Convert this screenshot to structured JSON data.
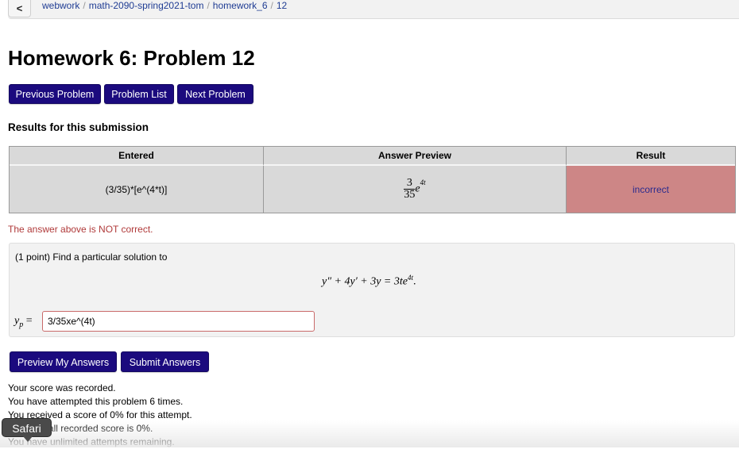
{
  "breadcrumb": {
    "back_icon": "chevron-left-icon",
    "back_glyph": "<",
    "items": [
      "webwork",
      "math-2090-spring2021-tom",
      "homework_6",
      "12"
    ],
    "separator": "/"
  },
  "page_title": "Homework 6: Problem 12",
  "nav_buttons": {
    "previous": "Previous Problem",
    "list": "Problem List",
    "next": "Next Problem"
  },
  "results": {
    "heading": "Results for this submission",
    "columns": [
      "Entered",
      "Answer Preview",
      "Result"
    ],
    "rows": [
      {
        "entered": "(3/35)*[e^(4*t)]",
        "preview": {
          "numerator": "3",
          "denominator": "35",
          "base": "e",
          "exponent": "4t"
        },
        "result": "incorrect"
      }
    ]
  },
  "feedback": "The answer above is NOT correct.",
  "problem": {
    "prompt": "(1 point) Find a particular solution to",
    "equation": "y″ + 4y′ + 3y = 3te",
    "equation_exponent": "4t",
    "equation_end": ".",
    "answer_label_base": "y",
    "answer_label_sub": "p",
    "answer_label_eq": " =",
    "answer_value": "3/35xe^(4t)"
  },
  "action_buttons": {
    "preview": "Preview My Answers",
    "submit": "Submit Answers"
  },
  "status_lines": [
    "Your score was recorded.",
    "You have attempted this problem 6 times.",
    "You received a score of 0% for this attempt.",
    "Your overall recorded score is 0%.",
    "You have unlimited attempts remaining."
  ],
  "tooltip": "Safari",
  "colors": {
    "button": "#1b0a7e",
    "incorrect_cell": "#cd8686",
    "error_text": "#b03a3a",
    "link": "#1f3c93"
  }
}
